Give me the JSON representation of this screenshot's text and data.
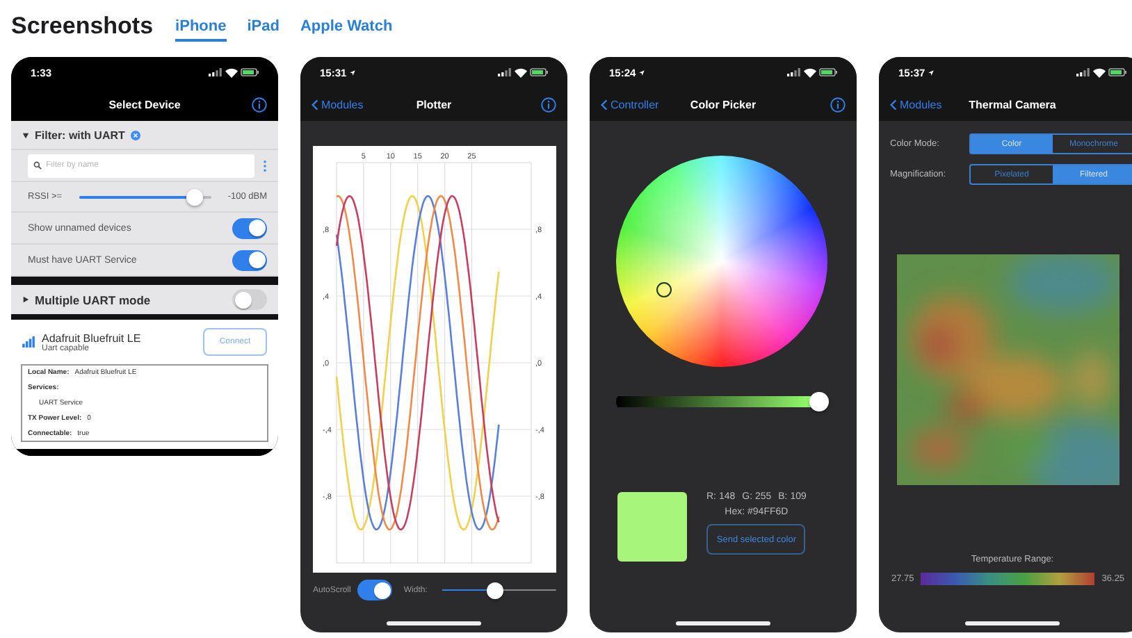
{
  "header": {
    "title": "Screenshots"
  },
  "tabs": [
    {
      "label": "iPhone",
      "selected": true
    },
    {
      "label": "iPad",
      "selected": false
    },
    {
      "label": "Apple Watch",
      "selected": false
    }
  ],
  "screens": [
    {
      "kind": "device_list",
      "status": {
        "time": "1:33"
      },
      "nav": {
        "title": "Select Device",
        "info_button": true
      },
      "filter": {
        "label": "Filter: with UART",
        "expanded": true
      },
      "search": {
        "placeholder": "Filter by name"
      },
      "rssi": {
        "label": "RSSI >=",
        "level": 0.88,
        "reading": "-100 dBM"
      },
      "switches": [
        {
          "label": "Show unnamed devices",
          "on": true
        },
        {
          "label": "Must have UART Service",
          "on": true
        }
      ],
      "multi_uart": {
        "label": "Multiple UART mode",
        "expanded": false,
        "on": false
      },
      "device": {
        "name": "Adafruit Bluefruit LE",
        "subtitle": "Uart capable",
        "button": "Connect",
        "details": [
          {
            "kind": "pair",
            "label": "Local Name:",
            "value": "Adafruit Bluefruit LE"
          },
          {
            "kind": "heading",
            "label": "Services:"
          },
          {
            "kind": "item",
            "value": "UART Service"
          },
          {
            "kind": "pair",
            "label": "TX Power Level:",
            "value": "0"
          },
          {
            "kind": "pair",
            "label": "Connectable:",
            "value": "true"
          }
        ]
      }
    },
    {
      "kind": "plotter",
      "status": {
        "time": "15:31",
        "location_arrow": true
      },
      "nav": {
        "back": "Modules",
        "title": "Plotter",
        "info_button": true
      },
      "home_indicator": true,
      "plot": {
        "x_labels": [
          "5",
          "10",
          "15",
          "20",
          "25"
        ],
        "y_labels_left": [
          ",8",
          ",4",
          ",0",
          "-,4",
          "-,8"
        ],
        "y_labels_right": [
          ",8",
          ",4",
          ",0",
          "-,4",
          "-,8"
        ]
      },
      "autoscroll": {
        "label": "AutoScroll",
        "on": true
      },
      "width_slider": {
        "label": "Width:",
        "level": 0.46
      }
    },
    {
      "kind": "color_picker",
      "status": {
        "time": "15:24",
        "location_arrow": true
      },
      "nav": {
        "back": "Controller",
        "title": "Color Picker",
        "info_button": true
      },
      "home_indicator": true,
      "brightness": {
        "level": 0.95
      },
      "components": [
        "R: 148",
        "G: 255",
        "B: 109"
      ],
      "hex": "Hex: #94FF6D",
      "button": "Send selected color"
    },
    {
      "kind": "thermal",
      "status": {
        "time": "15:37",
        "location_arrow": true
      },
      "nav": {
        "back": "Modules",
        "title": "Thermal Camera"
      },
      "home_indicator": true,
      "segments": [
        {
          "label": "Color Mode:",
          "options": [
            {
              "label": "Color",
              "selected": true
            },
            {
              "label": "Monochrome",
              "selected": false
            }
          ]
        },
        {
          "label": "Magnification:",
          "options": [
            {
              "label": "Pixelated",
              "selected": false
            },
            {
              "label": "Filtered",
              "selected": true
            }
          ]
        }
      ],
      "image": {
        "kind": "picture"
      },
      "range": {
        "label": "Temperature Range:",
        "min": "27.75",
        "max": "36.25"
      }
    }
  ]
}
